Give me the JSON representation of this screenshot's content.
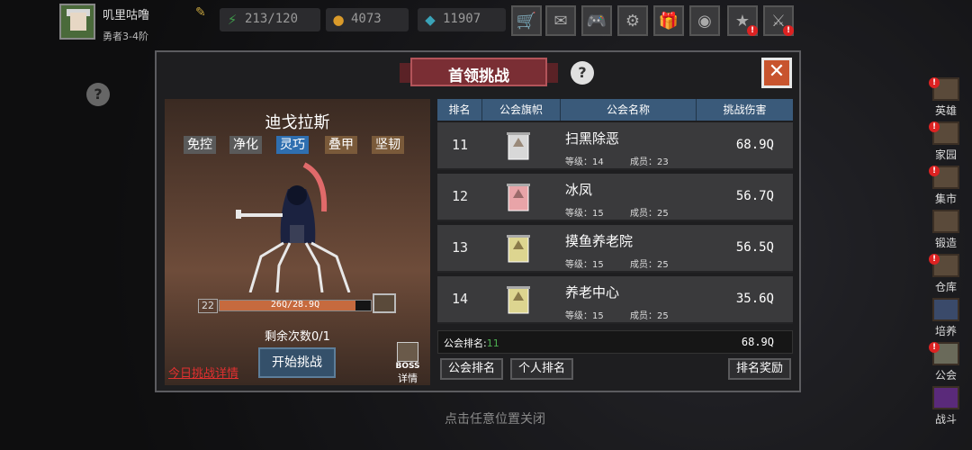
{
  "player": {
    "name": "叽里咕噜",
    "rank": "勇者3-4阶"
  },
  "resources": [
    {
      "icon": "energy-icon",
      "value": "213/120"
    },
    {
      "icon": "gold-coin-icon",
      "value": "4073"
    },
    {
      "icon": "gem-icon",
      "value": "11907"
    }
  ],
  "top_buttons": [
    "shop-cart-icon",
    "mail-icon",
    "gamepad-icon",
    "settings-gear-icon",
    "gift-icon",
    "colorwheel-icon",
    "event-icon",
    "battle-icon"
  ],
  "side_menu": [
    {
      "label": "英雄",
      "alert": "!"
    },
    {
      "label": "家园",
      "alert": "!"
    },
    {
      "label": "集市",
      "alert": "!"
    },
    {
      "label": "锻造",
      "alert": ""
    },
    {
      "label": "仓库",
      "alert": "!"
    },
    {
      "label": "培养",
      "alert": ""
    },
    {
      "label": "公会",
      "alert": "!"
    },
    {
      "label": "战斗",
      "alert": ""
    }
  ],
  "modal": {
    "title": "首领挑战",
    "boss": {
      "name": "迪戈拉斯",
      "tags": [
        "免控",
        "净化",
        "灵巧",
        "叠甲",
        "坚韧"
      ],
      "tag_colors": [
        "#5a5a5a",
        "#5a5a5a",
        "#2f6fb0",
        "#7a5a3a",
        "#7a5a3a"
      ],
      "level": "22",
      "hp_text": "26Q/28.9Q",
      "hp_fraction": 0.9,
      "remaining": "剩余次数0/1",
      "today_link": "今日挑战详情",
      "start_button": "开始挑战",
      "detail_top": "BOSS",
      "detail_bottom": "详情"
    },
    "table": {
      "headers": [
        "排名",
        "公会旗帜",
        "公会名称",
        "挑战伤害"
      ],
      "level_label": "等级：",
      "member_label": "成员：",
      "rows": [
        {
          "rank": "11",
          "name": "扫黑除恶",
          "level": "14",
          "members": "23",
          "damage": "68.9Q",
          "flag_color": "#d8d8d8"
        },
        {
          "rank": "12",
          "name": "冰凤",
          "level": "15",
          "members": "25",
          "damage": "56.7Q",
          "flag_color": "#e8a4a8"
        },
        {
          "rank": "13",
          "name": "摸鱼养老院",
          "level": "15",
          "members": "25",
          "damage": "56.5Q",
          "flag_color": "#ddd590"
        },
        {
          "rank": "14",
          "name": "养老中心",
          "level": "15",
          "members": "25",
          "damage": "35.6Q",
          "flag_color": "#ddd590"
        }
      ],
      "my_label": "公会排名:",
      "my_rank": "11",
      "my_damage": "68.9Q"
    },
    "buttons": {
      "guild_rank": "公会排名",
      "personal_rank": "个人排名",
      "rank_reward": "排名奖励"
    }
  },
  "footer": "点击任意位置关闭",
  "colors": {
    "accent_red": "#e23030",
    "header_blue": "#3a5a7a",
    "banner": "#7a2e34"
  }
}
